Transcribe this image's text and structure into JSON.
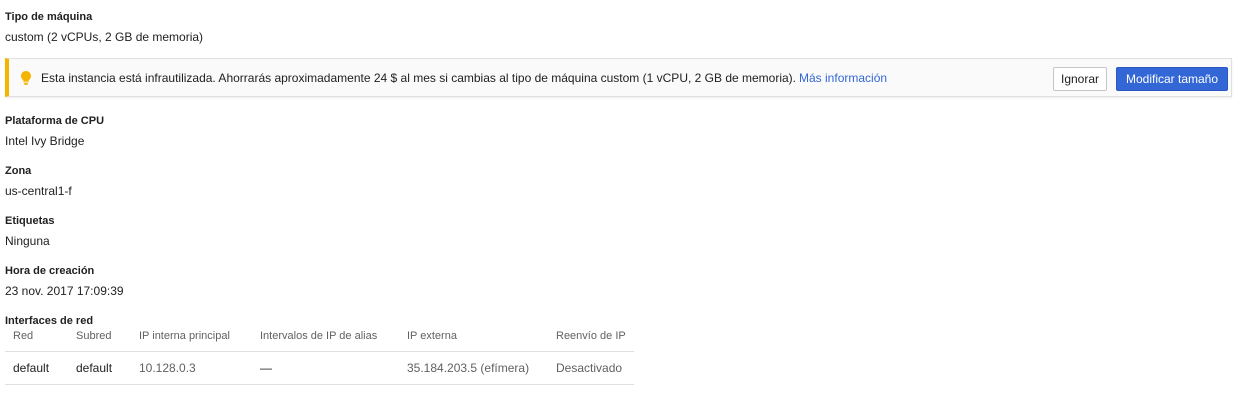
{
  "machine_type": {
    "label": "Tipo de máquina",
    "value": "custom (2 vCPUs, 2 GB de memoria)"
  },
  "recommendation": {
    "icon": "lightbulb-icon",
    "message": "Esta instancia está infrautilizada. Ahorrarás aproximadamente 24 $ al mes si cambias al tipo de máquina custom (1 vCPU, 2 GB de memoria).",
    "link": "Más información",
    "dismiss_label": "Ignorar",
    "resize_label": "Modificar tamaño",
    "accent_color": "#f4b400",
    "primary_color": "#3367d6"
  },
  "cpu_platform": {
    "label": "Plataforma de CPU",
    "value": "Intel Ivy Bridge"
  },
  "zone": {
    "label": "Zona",
    "value": "us-central1-f"
  },
  "labels": {
    "label": "Etiquetas",
    "value": "Ninguna"
  },
  "creation_time": {
    "label": "Hora de creación",
    "value": "23 nov. 2017 17:09:39"
  },
  "network_interfaces": {
    "label": "Interfaces de red",
    "columns": [
      "Red",
      "Subred",
      "IP interna principal",
      "Intervalos de IP de alias",
      "IP externa",
      "Reenvío de IP"
    ],
    "rows": [
      [
        "default",
        "default",
        "10.128.0.3",
        "—",
        "35.184.203.5 (efímera)",
        "Desactivado"
      ]
    ]
  }
}
